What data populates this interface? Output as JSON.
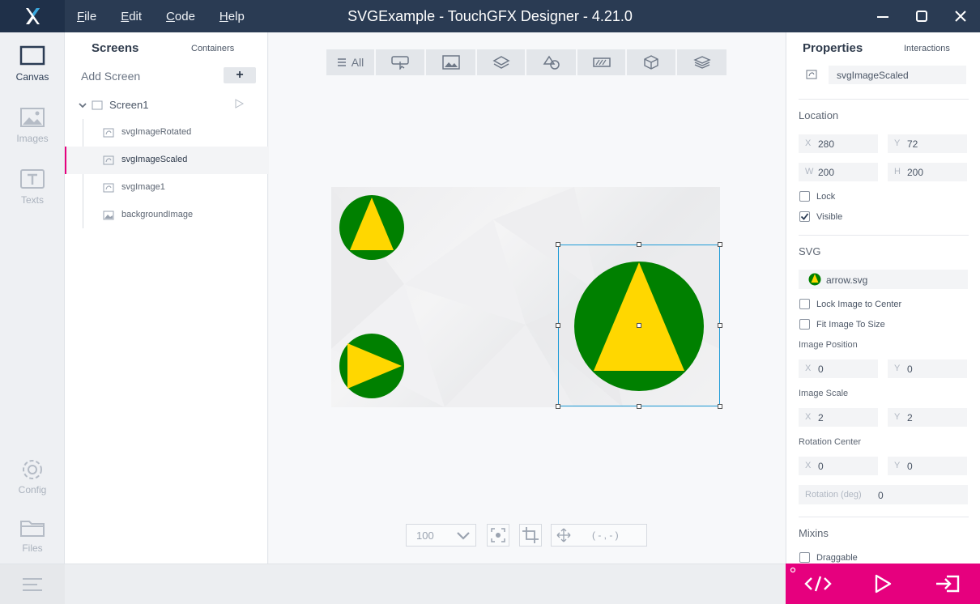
{
  "titlebar": {
    "title": "SVGExample - TouchGFX Designer - 4.21.0",
    "menu": [
      "File",
      "Edit",
      "Code",
      "Help"
    ]
  },
  "nav": {
    "canvas": "Canvas",
    "images": "Images",
    "texts": "Texts",
    "config": "Config",
    "files": "Files"
  },
  "tree": {
    "tab_screens": "Screens",
    "tab_containers": "Containers",
    "add_screen": "Add Screen",
    "add_button": "+",
    "screen": "Screen1",
    "items": [
      "svgImageRotated",
      "svgImageScaled",
      "svgImage1",
      "backgroundImage"
    ],
    "selected_index": 1
  },
  "toolbar": {
    "all_label": "All"
  },
  "canvas": {
    "zoom": "100",
    "coords": "( - , - )",
    "colors": {
      "green": "#008000",
      "yellow": "#ffd700",
      "selection": "#1e9bd7"
    }
  },
  "props": {
    "tab_properties": "Properties",
    "tab_interactions": "Interactions",
    "widget_name": "svgImageScaled",
    "location": {
      "title": "Location",
      "x_key": "X",
      "x": "280",
      "y_key": "Y",
      "y": "72",
      "w_key": "W",
      "w": "200",
      "h_key": "H",
      "h": "200"
    },
    "lock": "Lock",
    "visible": "Visible",
    "svg": {
      "title": "SVG",
      "file": "arrow.svg",
      "lock_center": "Lock Image to Center",
      "fit_size": "Fit Image To Size",
      "image_position": "Image Position",
      "pos_x_key": "X",
      "pos_x": "0",
      "pos_y_key": "Y",
      "pos_y": "0",
      "image_scale": "Image Scale",
      "scale_x_key": "X",
      "scale_x": "2",
      "scale_y_key": "Y",
      "scale_y": "2",
      "rotation_center": "Rotation Center",
      "rc_x_key": "X",
      "rc_x": "0",
      "rc_y_key": "Y",
      "rc_y": "0",
      "rotation_label": "Rotation (deg)",
      "rotation": "0"
    },
    "mixins": "Mixins",
    "draggable": "Draggable"
  }
}
